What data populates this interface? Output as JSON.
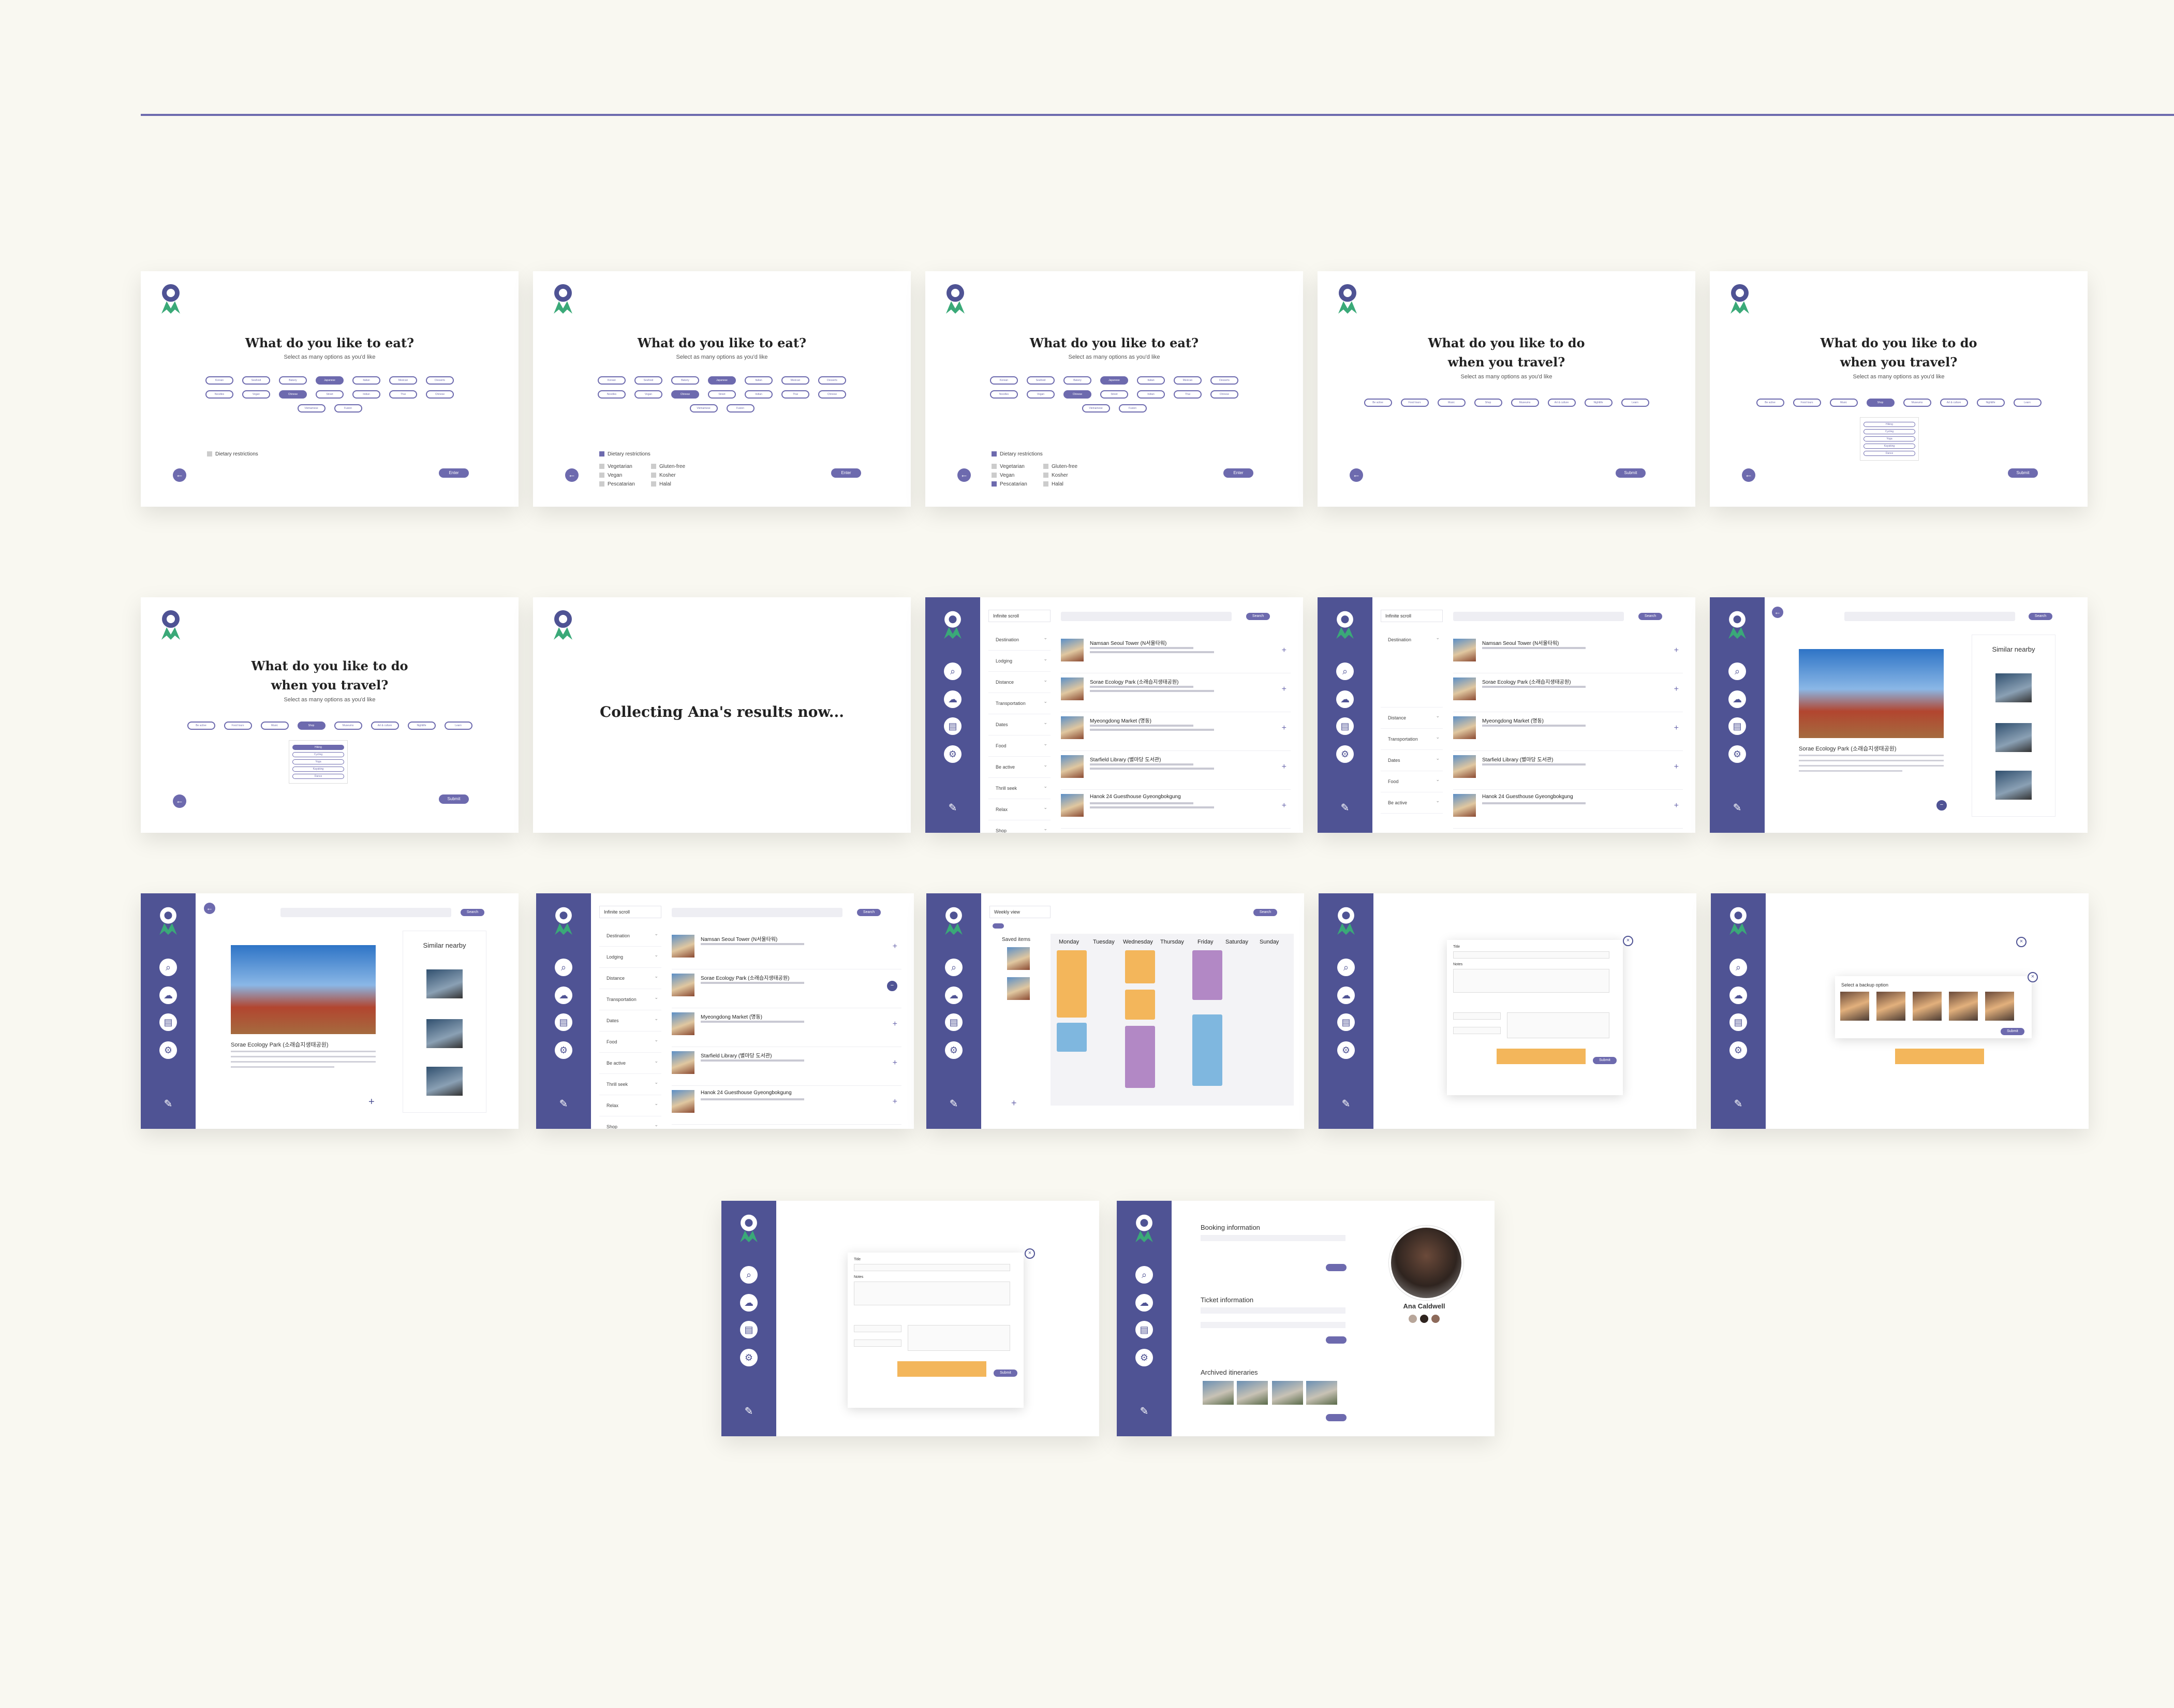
{
  "colors": {
    "background": "#f9f8f1",
    "accent": "#6d6aae",
    "sidebar": "#4f5394",
    "highlight": "#f3b65b"
  },
  "survey": {
    "eat_title": "What do you like to eat?",
    "do_title_1": "What do you like to do",
    "do_title_2": "when you travel?",
    "subtitle": "Select as many options as you'd like",
    "food_chips": [
      "Korean",
      "Seafood",
      "Bakery",
      "Japanese",
      "Italian",
      "Mexican",
      "Desserts",
      "Noodles",
      "Vegan",
      "Chinese",
      "Street",
      "Indian",
      "Thai",
      "Chinese",
      "Vietnamese",
      "Fusion"
    ],
    "activity_chips": [
      "Be active",
      "Food tours",
      "Music",
      "Shop",
      "Museums",
      "Art & culture",
      "Nightlife",
      "Learn"
    ],
    "dropdown_options": [
      "Hiking",
      "Cycling",
      "Yoga",
      "Kayaking",
      "Dance"
    ],
    "dietary": "Dietary restrictions",
    "diet_options": [
      "Vegetarian",
      "Gluten-free",
      "Vegan",
      "Kosher",
      "Pescatarian",
      "Halal"
    ],
    "enter": "Enter",
    "submit": "Submit",
    "collecting": "Collecting Ana's results now..."
  },
  "app": {
    "view_infinite": "Infinite scroll",
    "view_weekly": "Weekly view",
    "search": "Search",
    "filters": [
      "Destination",
      "Lodging",
      "Distance",
      "Transportation",
      "Dates",
      "Food",
      "Be active",
      "Thrill seek",
      "Relax",
      "Shop"
    ],
    "results": [
      {
        "title": "Namsan Seoul Tower (N서울타워)"
      },
      {
        "title": "Sorae Ecology Park (소래습지생태공원)"
      },
      {
        "title": "Myeongdong Market (명동)"
      },
      {
        "title": "Starfield Library (별마당 도서관)"
      },
      {
        "title": "Hanok 24 Guesthouse Gyeongbokgung"
      }
    ],
    "detail_title": "Sorae Ecology Park (소래습지생태공원)",
    "similar": "Similar nearby",
    "saved_items": "Saved items",
    "days": [
      "Monday",
      "Tuesday",
      "Wednesday",
      "Thursday",
      "Friday",
      "Saturday",
      "Sunday"
    ],
    "modal_title": "Title",
    "modal_notes": "Notes",
    "backup_title": "Select a backup option",
    "profile": {
      "booking": "Booking information",
      "ticket": "Ticket information",
      "archived": "Archived itineraries",
      "name": "Ana Caldwell"
    }
  }
}
